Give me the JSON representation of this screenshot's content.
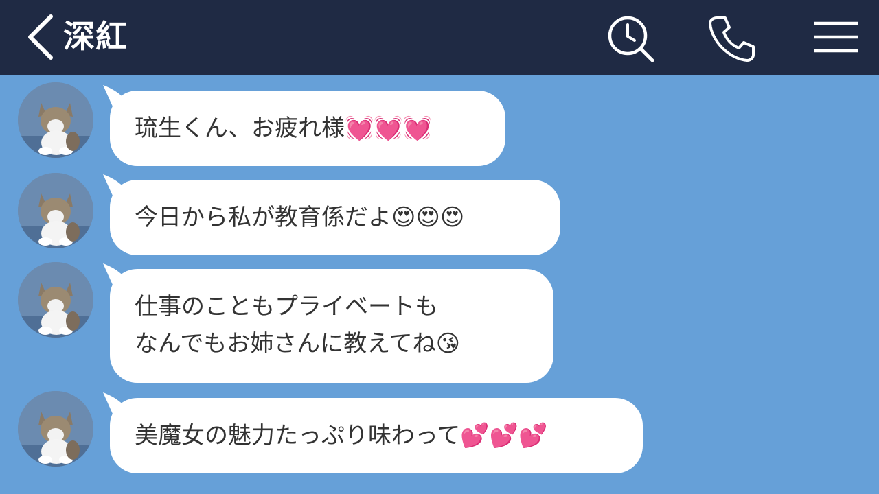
{
  "header": {
    "title": "深紅",
    "back_icon": "chevron-left-icon",
    "search_icon": "search-icon",
    "call_icon": "phone-icon",
    "menu_icon": "hamburger-menu-icon"
  },
  "colors": {
    "header_bg": "#1f2a44",
    "chat_bg": "#66a0d8",
    "bubble_bg": "#ffffff",
    "text": "#333333"
  },
  "messages": [
    {
      "text": "琉生くん、お疲れ様💓💓💓"
    },
    {
      "text": "今日から私が教育係だよ😍😍😍"
    },
    {
      "text": "仕事のこともプライベートも\nなんでもお姉さんに教えてね😘"
    },
    {
      "text": "美魔女の魅力たっぷり味わって💕💕💕"
    }
  ]
}
